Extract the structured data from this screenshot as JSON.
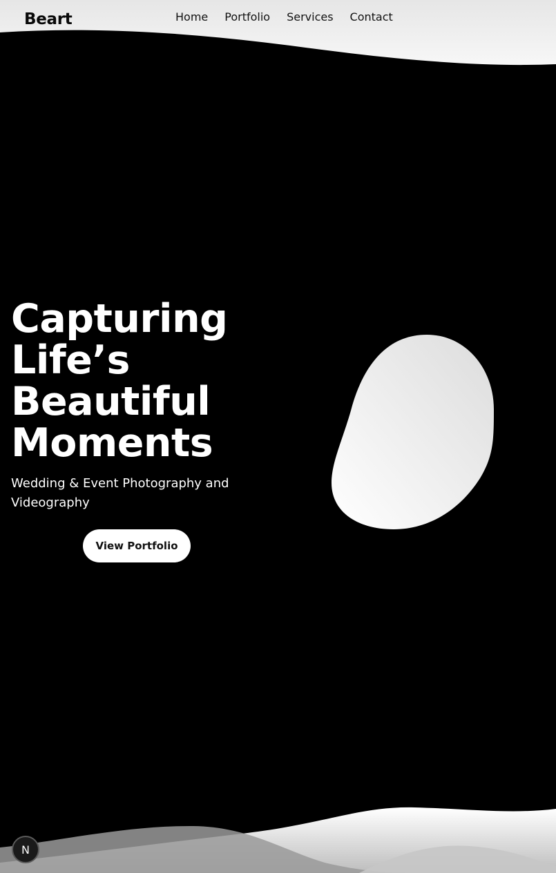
{
  "brand": {
    "name": "Beart"
  },
  "nav": {
    "items": [
      {
        "label": "Home"
      },
      {
        "label": "Portfolio"
      },
      {
        "label": "Services"
      },
      {
        "label": "Contact"
      }
    ]
  },
  "hero": {
    "title_lines": [
      "Capturing",
      "Life’s",
      "Beautiful",
      "Moments"
    ],
    "subtitle": "Wedding & Event Photography and Videography",
    "cta_label": "View Portfolio"
  },
  "dev_badge": {
    "label": "N"
  },
  "colors": {
    "background": "#000000",
    "accent": "#ffffff",
    "wave_light": "#f2f2f2",
    "wave_mid": "#a9a9a9"
  },
  "icons": {
    "blob_shape": "abstract-blob-icon",
    "dev_badge": "nextjs-badge-icon"
  }
}
